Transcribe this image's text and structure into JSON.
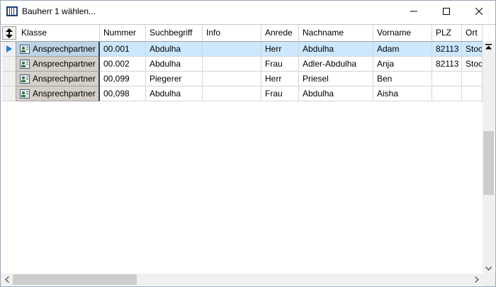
{
  "window": {
    "title": "Bauherr 1 wählen...",
    "minimize_icon": "minimize-icon",
    "maximize_icon": "maximize-icon",
    "close_icon": "close-icon",
    "app_icon": "app-icon"
  },
  "grid": {
    "sort_icon": "sort-updown-icon",
    "columns": [
      "Klasse",
      "Nummer",
      "Suchbegriff",
      "Info",
      "Anrede",
      "Nachname",
      "Vorname",
      "PLZ",
      "Ort"
    ],
    "rows": [
      {
        "klasse": "Ansprechpartner",
        "nummer": "00.001",
        "suchbegriff": "Abdulha",
        "info": "",
        "anrede": "Herr",
        "nachname": "Abdulha",
        "vorname": "Adam",
        "plz": "82113",
        "ort": "Stock",
        "selected": true
      },
      {
        "klasse": "Ansprechpartner",
        "nummer": "00.002",
        "suchbegriff": "Abdulha",
        "info": "",
        "anrede": "Frau",
        "nachname": "Adler-Abdulha",
        "vorname": "Anja",
        "plz": "82113",
        "ort": "Stock",
        "selected": false
      },
      {
        "klasse": "Ansprechpartner",
        "nummer": "00,099",
        "suchbegriff": "Piegerer",
        "info": "",
        "anrede": "Herr",
        "nachname": "Priesel",
        "vorname": "Ben",
        "plz": "",
        "ort": "",
        "selected": false
      },
      {
        "klasse": "Ansprechpartner",
        "nummer": "00,098",
        "suchbegriff": "Abdulha",
        "info": "",
        "anrede": "Frau",
        "nachname": "Abdulha",
        "vorname": "Aisha",
        "plz": "",
        "ort": "",
        "selected": false
      }
    ],
    "current_row_icon": "current-row-arrow-icon",
    "klasse_icon": "contact-card-icon"
  },
  "colors": {
    "selection": "#cce8ff",
    "klasse_bg": "#d4d0c8",
    "current_row_arrow": "#1e7fd8"
  }
}
